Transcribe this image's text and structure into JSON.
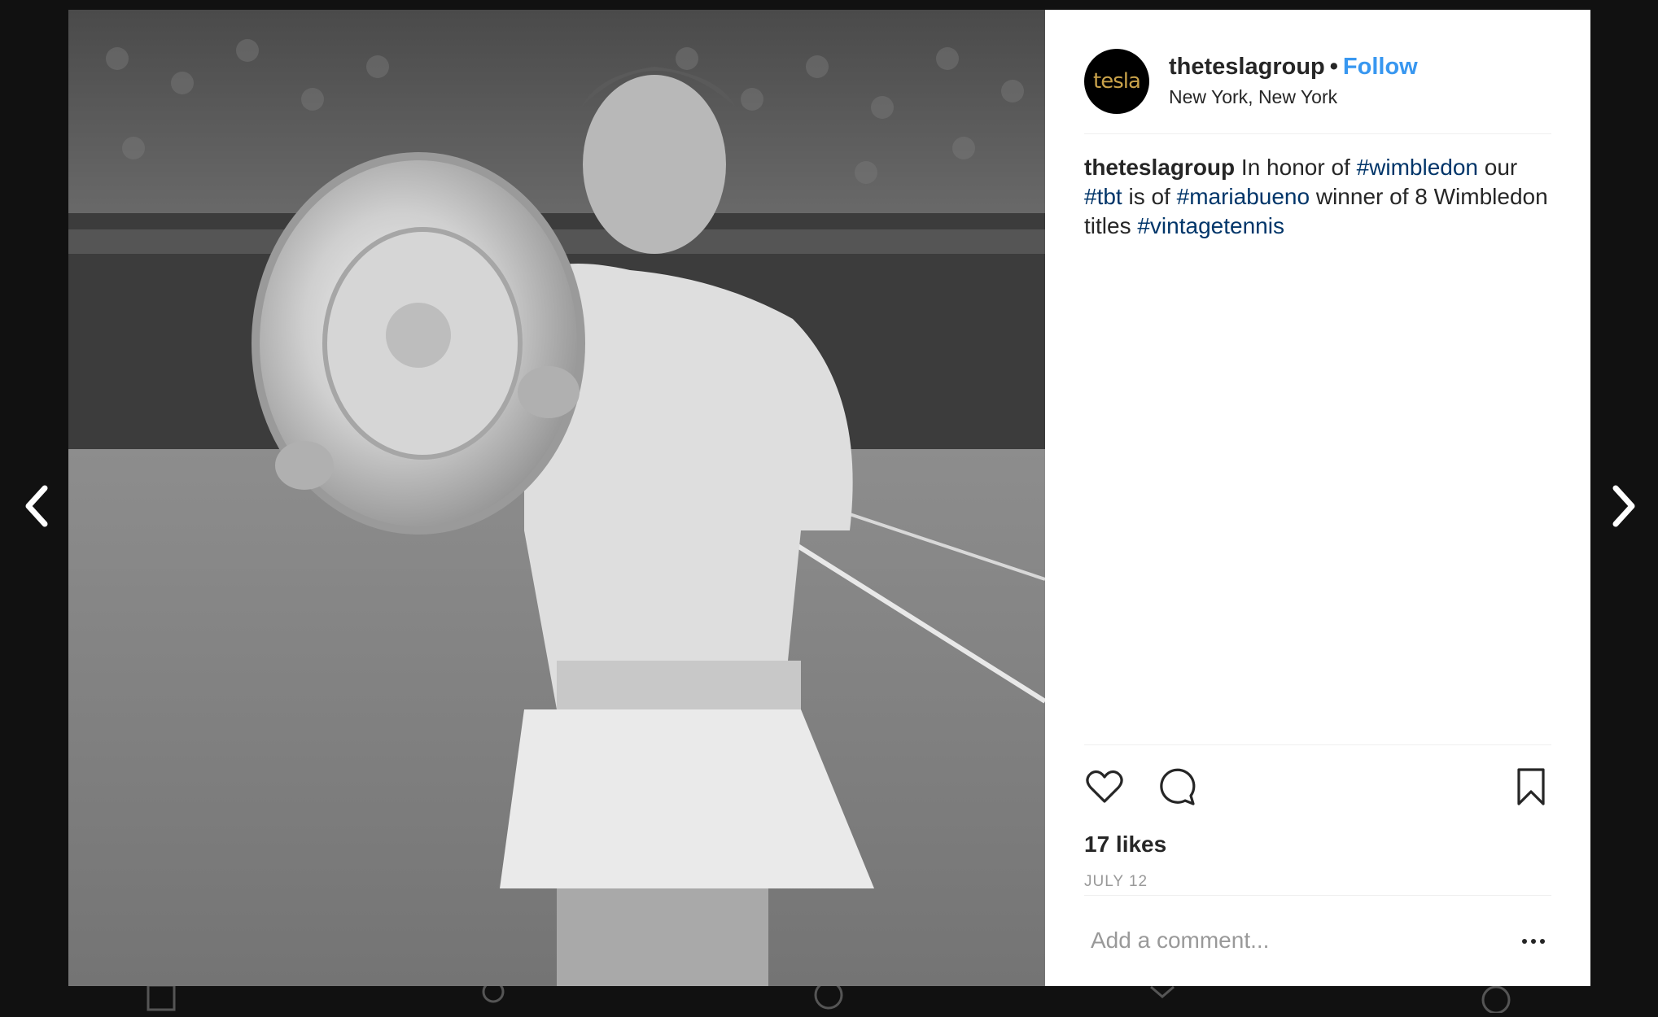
{
  "post": {
    "username": "theteslagroup",
    "separator": "•",
    "follow_label": "Follow",
    "location": "New York, New York",
    "avatar_text": "tesla",
    "caption": {
      "username": "theteslagroup",
      "parts": [
        {
          "text": " In honor of ",
          "tag": false
        },
        {
          "text": "#wimbledon",
          "tag": true
        },
        {
          "text": " our ",
          "tag": false
        },
        {
          "text": "#tbt",
          "tag": true
        },
        {
          "text": " is of ",
          "tag": false
        },
        {
          "text": "#mariabueno",
          "tag": true
        },
        {
          "text": " winner of 8 Wimbledon titles ",
          "tag": false
        },
        {
          "text": "#vintagetennis",
          "tag": true
        }
      ]
    },
    "likes": "17 likes",
    "date": "JULY 12",
    "comment_placeholder": "Add a comment..."
  },
  "icons": {
    "prev": "chevron-left-icon",
    "next": "chevron-right-icon",
    "like": "heart-icon",
    "comment": "comment-bubble-icon",
    "save": "bookmark-icon",
    "more": "ellipsis-icon"
  },
  "colors": {
    "link": "#003569",
    "follow": "#3897f0",
    "backdrop": "#111111"
  }
}
